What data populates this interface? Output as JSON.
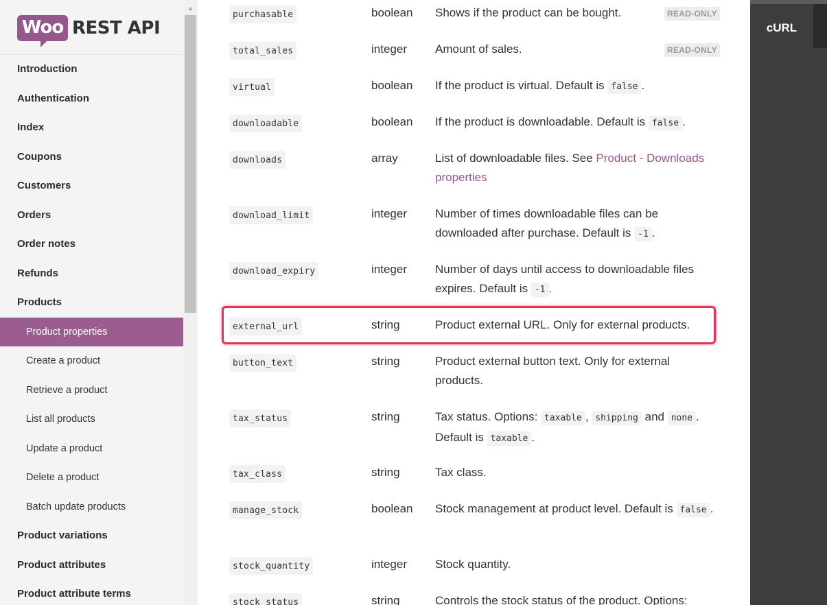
{
  "logo": {
    "badge": "Woo",
    "title": "REST API"
  },
  "sidebar": {
    "items": [
      {
        "label": "Introduction",
        "level": "top",
        "active": false
      },
      {
        "label": "Authentication",
        "level": "top",
        "active": false
      },
      {
        "label": "Index",
        "level": "top",
        "active": false
      },
      {
        "label": "Coupons",
        "level": "top",
        "active": false
      },
      {
        "label": "Customers",
        "level": "top",
        "active": false
      },
      {
        "label": "Orders",
        "level": "top",
        "active": false
      },
      {
        "label": "Order notes",
        "level": "top",
        "active": false
      },
      {
        "label": "Refunds",
        "level": "top",
        "active": false
      },
      {
        "label": "Products",
        "level": "top",
        "active": false
      },
      {
        "label": "Product properties",
        "level": "sub",
        "active": true
      },
      {
        "label": "Create a product",
        "level": "sub",
        "active": false
      },
      {
        "label": "Retrieve a product",
        "level": "sub",
        "active": false
      },
      {
        "label": "List all products",
        "level": "sub",
        "active": false
      },
      {
        "label": "Update a product",
        "level": "sub",
        "active": false
      },
      {
        "label": "Delete a product",
        "level": "sub",
        "active": false
      },
      {
        "label": "Batch update products",
        "level": "sub",
        "active": false
      },
      {
        "label": "Product variations",
        "level": "top",
        "active": false
      },
      {
        "label": "Product attributes",
        "level": "top",
        "active": false
      },
      {
        "label": "Product attribute terms",
        "level": "top",
        "active": false
      }
    ]
  },
  "properties": [
    {
      "name": "purchasable",
      "type": "boolean",
      "desc": "Shows if the product can be bought.",
      "badge": "READ-ONLY"
    },
    {
      "name": "total_sales",
      "type": "integer",
      "desc": "Amount of sales.",
      "badge": "READ-ONLY"
    },
    {
      "name": "virtual",
      "type": "boolean",
      "desc_pre": "If the product is virtual. Default is ",
      "code1": "false",
      "desc_post": "."
    },
    {
      "name": "downloadable",
      "type": "boolean",
      "desc_pre": "If the product is downloadable. Default is ",
      "code1": "false",
      "desc_post": "."
    },
    {
      "name": "downloads",
      "type": "array",
      "desc_pre": "List of downloadable files. See ",
      "link": "Product - Downloads properties"
    },
    {
      "name": "download_limit",
      "type": "integer",
      "desc_pre": "Number of times downloadable files can be downloaded after purchase. Default is ",
      "code1": "-1",
      "desc_post": "."
    },
    {
      "name": "download_expiry",
      "type": "integer",
      "desc_pre": "Number of days until access to downloadable files expires. Default is ",
      "code1": "-1",
      "desc_post": "."
    },
    {
      "name": "external_url",
      "type": "string",
      "desc": "Product external URL. Only for external products."
    },
    {
      "name": "button_text",
      "type": "string",
      "desc": "Product external button text. Only for external products."
    },
    {
      "name": "tax_status",
      "type": "string",
      "desc_pre": "Tax status. Options: ",
      "code1": "taxable",
      "sep1": ", ",
      "code2": "shipping",
      "sep2": " and ",
      "code3": "none",
      "sep3": ". Default is ",
      "code4": "taxable",
      "desc_post": "."
    },
    {
      "name": "tax_class",
      "type": "string",
      "desc": "Tax class."
    },
    {
      "name": "manage_stock",
      "type": "boolean",
      "desc_pre": "Stock management at product level. Default is ",
      "code1": "false",
      "desc_post": "."
    },
    {
      "name": "stock_quantity",
      "type": "integer",
      "desc": "Stock quantity."
    },
    {
      "name": "stock_status",
      "type": "string",
      "desc": "Controls the stock status of the product. Options:"
    }
  ],
  "right_panel": {
    "tab": "cURL"
  },
  "colors": {
    "brand": "#96588a",
    "active_nav": "#9b5c8f",
    "highlight": "#e8315a",
    "dark_panel": "#3d3d3d"
  },
  "scrollbar": {
    "up_icon": "▲"
  }
}
